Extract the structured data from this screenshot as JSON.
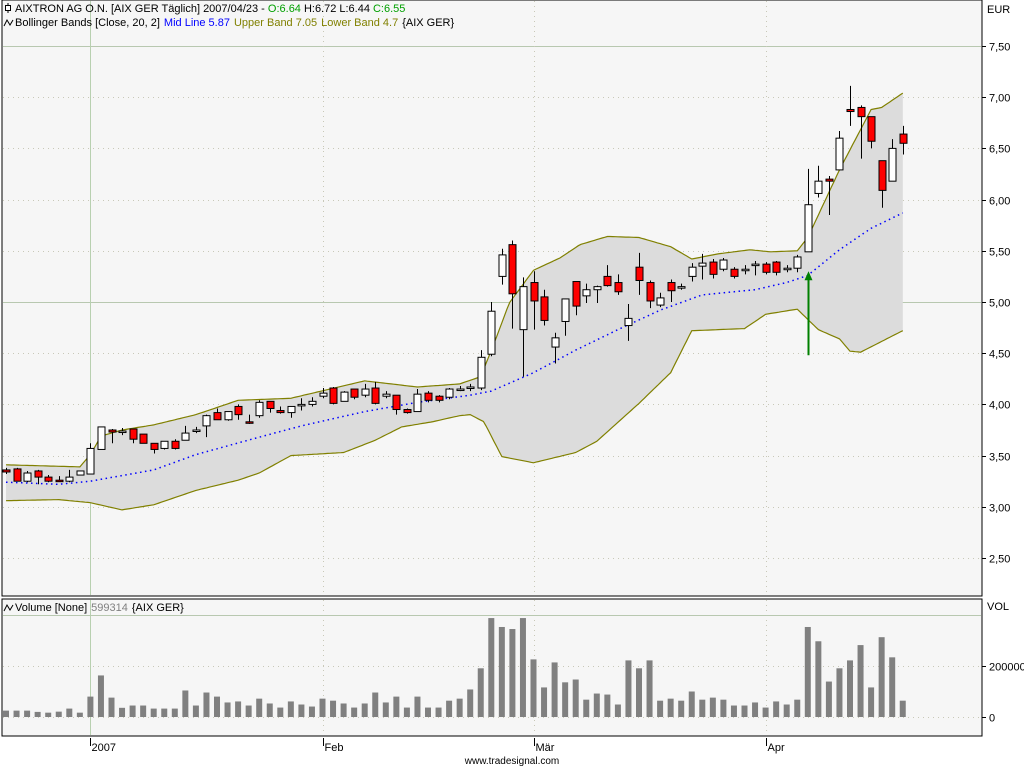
{
  "legend": {
    "symbol": "AIXTRON AG O.N. [AIX GER  Täglich] 2007/04/23 - ",
    "open": "O:6.64",
    "high": "H:6.72",
    "low": "L:6.44",
    "close": "C:6.55",
    "bb_name": "Bollinger Bands [Close, 20, 2]",
    "bb_mid": "Mid Line 5.87",
    "bb_upper": "Upper Band 7.05",
    "bb_lower": "Lower Band 4.7",
    "bb_symbol": "{AIX GER}",
    "vol_name": "Volume [None]",
    "vol_value": "599314",
    "vol_symbol": "{AIX GER}"
  },
  "footer": "www.tradesignal.com",
  "colors": {
    "up_body": "#ffffff",
    "down_body": "#ff0000",
    "band_fill": "#dcdcdc",
    "band_line": "#808000",
    "mid_line": "#0000ff",
    "volume": "#808080",
    "arrow": "#008000",
    "legend_green": "#00a000",
    "legend_blue": "#0000ff",
    "legend_olive": "#808000",
    "legend_gray": "#808080"
  },
  "chart_data": [
    {
      "type": "candlestick",
      "title": "AIXTRON AG O.N. [AIX GER Täglich]",
      "ylabel": "EUR",
      "ylim": [
        2.2,
        7.9
      ],
      "yticks": [
        {
          "value": 7.5,
          "label": "7,50"
        },
        {
          "value": 7.0,
          "label": "7,00"
        },
        {
          "value": 6.5,
          "label": "6,50"
        },
        {
          "value": 6.0,
          "label": "6,00"
        },
        {
          "value": 5.5,
          "label": "5,50"
        },
        {
          "value": 5.0,
          "label": "5,00"
        },
        {
          "value": 4.5,
          "label": "4,50"
        },
        {
          "value": 4.0,
          "label": "4,00"
        },
        {
          "value": 3.5,
          "label": "3,50"
        },
        {
          "value": 3.0,
          "label": "3,00"
        },
        {
          "value": 2.5,
          "label": "2,50"
        }
      ],
      "xticks": [
        {
          "index": 8,
          "label": "2007"
        },
        {
          "index": 30,
          "label": "Feb"
        },
        {
          "index": 50,
          "label": "Mär"
        },
        {
          "index": 72,
          "label": "Apr"
        }
      ],
      "ohlc": [
        [
          3.36,
          3.38,
          3.32,
          3.34
        ],
        [
          3.37,
          3.38,
          3.25,
          3.25
        ],
        [
          3.25,
          3.35,
          3.24,
          3.33
        ],
        [
          3.35,
          3.36,
          3.22,
          3.29
        ],
        [
          3.29,
          3.31,
          3.24,
          3.25
        ],
        [
          3.26,
          3.3,
          3.25,
          3.25
        ],
        [
          3.25,
          3.36,
          3.24,
          3.29
        ],
        [
          3.31,
          3.35,
          3.31,
          3.35
        ],
        [
          3.32,
          3.62,
          3.32,
          3.57
        ],
        [
          3.56,
          3.78,
          3.56,
          3.78
        ],
        [
          3.75,
          3.76,
          3.62,
          3.73
        ],
        [
          3.74,
          3.77,
          3.7,
          3.74
        ],
        [
          3.76,
          3.76,
          3.62,
          3.66
        ],
        [
          3.71,
          3.71,
          3.62,
          3.62
        ],
        [
          3.62,
          3.62,
          3.52,
          3.56
        ],
        [
          3.57,
          3.64,
          3.56,
          3.64
        ],
        [
          3.64,
          3.66,
          3.56,
          3.57
        ],
        [
          3.65,
          3.79,
          3.65,
          3.72
        ],
        [
          3.75,
          3.78,
          3.72,
          3.75
        ],
        [
          3.79,
          3.9,
          3.68,
          3.89
        ],
        [
          3.92,
          3.96,
          3.85,
          3.85
        ],
        [
          3.85,
          3.93,
          3.84,
          3.93
        ],
        [
          3.98,
          4.0,
          3.85,
          3.9
        ],
        [
          3.83,
          3.9,
          3.81,
          3.82
        ],
        [
          3.89,
          4.04,
          3.87,
          4.02
        ],
        [
          4.03,
          4.03,
          3.92,
          3.96
        ],
        [
          3.94,
          3.98,
          3.91,
          3.92
        ],
        [
          3.92,
          3.98,
          3.87,
          3.98
        ],
        [
          4.0,
          4.06,
          3.94,
          4.0
        ],
        [
          4.0,
          4.07,
          3.98,
          4.03
        ],
        [
          4.08,
          4.16,
          4.06,
          4.11
        ],
        [
          4.16,
          4.17,
          4.0,
          4.01
        ],
        [
          4.03,
          4.13,
          4.03,
          4.12
        ],
        [
          4.15,
          4.15,
          4.05,
          4.07
        ],
        [
          4.09,
          4.2,
          4.07,
          4.15
        ],
        [
          4.16,
          4.22,
          4.0,
          4.01
        ],
        [
          4.08,
          4.13,
          4.06,
          4.1
        ],
        [
          4.09,
          4.09,
          3.9,
          3.95
        ],
        [
          3.95,
          3.96,
          3.91,
          3.92
        ],
        [
          3.93,
          4.15,
          3.93,
          4.1
        ],
        [
          4.11,
          4.13,
          4.02,
          4.04
        ],
        [
          4.08,
          4.09,
          4.02,
          4.04
        ],
        [
          4.07,
          4.16,
          4.05,
          4.15
        ],
        [
          4.15,
          4.18,
          4.13,
          4.15
        ],
        [
          4.17,
          4.2,
          4.13,
          4.17
        ],
        [
          4.16,
          4.53,
          4.14,
          4.46
        ],
        [
          4.49,
          5.0,
          4.47,
          4.91
        ],
        [
          5.25,
          5.52,
          5.17,
          5.46
        ],
        [
          5.56,
          5.6,
          4.74,
          5.08
        ],
        [
          4.73,
          5.24,
          4.27,
          5.15
        ],
        [
          5.19,
          5.3,
          4.73,
          5.01
        ],
        [
          5.05,
          5.12,
          4.77,
          4.82
        ],
        [
          4.56,
          4.7,
          4.4,
          4.65
        ],
        [
          4.81,
          5.03,
          4.67,
          5.03
        ],
        [
          5.2,
          5.2,
          4.87,
          4.96
        ],
        [
          5.06,
          5.18,
          4.99,
          5.12
        ],
        [
          5.12,
          5.16,
          4.99,
          5.15
        ],
        [
          5.25,
          5.36,
          5.15,
          5.16
        ],
        [
          5.19,
          5.27,
          5.07,
          5.1
        ],
        [
          4.77,
          4.98,
          4.62,
          4.84
        ],
        [
          5.34,
          5.48,
          5.07,
          5.21
        ],
        [
          5.19,
          5.21,
          4.94,
          5.01
        ],
        [
          4.97,
          5.09,
          4.95,
          5.04
        ],
        [
          5.19,
          5.22,
          5.0,
          5.11
        ],
        [
          5.15,
          5.18,
          5.12,
          5.15
        ],
        [
          5.25,
          5.38,
          5.2,
          5.34
        ],
        [
          5.35,
          5.47,
          5.22,
          5.38
        ],
        [
          5.39,
          5.42,
          5.23,
          5.27
        ],
        [
          5.32,
          5.43,
          5.3,
          5.41
        ],
        [
          5.32,
          5.34,
          5.23,
          5.25
        ],
        [
          5.32,
          5.36,
          5.27,
          5.32
        ],
        [
          5.37,
          5.4,
          5.26,
          5.37
        ],
        [
          5.37,
          5.39,
          5.27,
          5.29
        ],
        [
          5.39,
          5.4,
          5.26,
          5.29
        ],
        [
          5.33,
          5.36,
          5.29,
          5.33
        ],
        [
          5.33,
          5.46,
          5.29,
          5.44
        ],
        [
          5.49,
          6.3,
          5.49,
          5.95
        ],
        [
          6.06,
          6.33,
          6.02,
          6.18
        ],
        [
          6.2,
          6.23,
          5.85,
          6.18
        ],
        [
          6.29,
          6.67,
          6.29,
          6.6
        ],
        [
          6.88,
          7.11,
          6.72,
          6.86
        ],
        [
          6.9,
          6.92,
          6.4,
          6.81
        ],
        [
          6.81,
          6.81,
          6.5,
          6.57
        ],
        [
          6.38,
          6.38,
          5.92,
          6.09
        ],
        [
          6.18,
          6.59,
          6.18,
          6.5
        ],
        [
          6.64,
          6.72,
          6.44,
          6.55
        ]
      ],
      "bollinger": {
        "upper": [
          [
            0,
            3.41
          ],
          [
            7,
            3.39
          ],
          [
            8,
            3.51
          ],
          [
            9,
            3.69
          ],
          [
            11,
            3.75
          ],
          [
            14,
            3.8
          ],
          [
            18,
            3.9
          ],
          [
            22,
            4.04
          ],
          [
            27,
            4.06
          ],
          [
            34,
            4.23
          ],
          [
            39,
            4.17
          ],
          [
            43,
            4.2
          ],
          [
            45,
            4.27
          ],
          [
            46.5,
            4.66
          ],
          [
            47.7,
            4.99
          ],
          [
            50,
            5.31
          ],
          [
            52.5,
            5.43
          ],
          [
            54.4,
            5.56
          ],
          [
            57,
            5.64
          ],
          [
            60,
            5.63
          ],
          [
            63,
            5.54
          ],
          [
            65,
            5.42
          ],
          [
            67.5,
            5.47
          ],
          [
            70.5,
            5.51
          ],
          [
            72.5,
            5.49
          ],
          [
            75,
            5.5
          ],
          [
            76,
            5.63
          ],
          [
            79,
            6.29
          ],
          [
            82,
            6.88
          ],
          [
            83,
            6.9
          ],
          [
            85,
            7.04
          ]
        ],
        "mid": [
          [
            0,
            3.24
          ],
          [
            5,
            3.22
          ],
          [
            8,
            3.25
          ],
          [
            14,
            3.36
          ],
          [
            18,
            3.51
          ],
          [
            24,
            3.68
          ],
          [
            28,
            3.79
          ],
          [
            34,
            3.93
          ],
          [
            39,
            4.02
          ],
          [
            44,
            4.09
          ],
          [
            46,
            4.13
          ],
          [
            50,
            4.31
          ],
          [
            54,
            4.53
          ],
          [
            58,
            4.73
          ],
          [
            62,
            4.92
          ],
          [
            66,
            5.07
          ],
          [
            71,
            5.12
          ],
          [
            74,
            5.19
          ],
          [
            76,
            5.26
          ],
          [
            79,
            5.51
          ],
          [
            82,
            5.72
          ],
          [
            85,
            5.87
          ]
        ],
        "lower": [
          [
            0,
            3.06
          ],
          [
            5,
            3.07
          ],
          [
            8,
            3.04
          ],
          [
            11,
            2.97
          ],
          [
            14,
            3.02
          ],
          [
            18,
            3.16
          ],
          [
            22,
            3.26
          ],
          [
            24,
            3.33
          ],
          [
            27,
            3.5
          ],
          [
            32,
            3.53
          ],
          [
            35,
            3.65
          ],
          [
            37.5,
            3.78
          ],
          [
            40.4,
            3.83
          ],
          [
            43,
            3.89
          ],
          [
            44,
            3.9
          ],
          [
            45.3,
            3.83
          ],
          [
            47,
            3.49
          ],
          [
            50,
            3.43
          ],
          [
            54,
            3.53
          ],
          [
            56,
            3.64
          ],
          [
            60,
            4.01
          ],
          [
            63,
            4.31
          ],
          [
            65,
            4.72
          ],
          [
            70,
            4.74
          ],
          [
            72,
            4.88
          ],
          [
            75,
            4.93
          ],
          [
            77,
            4.73
          ],
          [
            79,
            4.64
          ],
          [
            80,
            4.52
          ],
          [
            81,
            4.51
          ],
          [
            85,
            4.72
          ]
        ]
      },
      "annotations": [
        {
          "type": "arrow",
          "index": 76,
          "from": 4.48,
          "to": 5.3
        }
      ],
      "grid": true
    },
    {
      "type": "bar",
      "title": "Volume [None]",
      "ylabel": "VOL",
      "ylim": [
        -75000,
        470000
      ],
      "yticks": [
        {
          "value": 200000,
          "label": "200000"
        },
        {
          "value": 0,
          "label": "0"
        }
      ],
      "values": [
        25000,
        25000,
        25000,
        20000,
        17000,
        21000,
        33000,
        17000,
        80000,
        163000,
        76000,
        36000,
        45000,
        45000,
        33000,
        33000,
        33000,
        104000,
        45000,
        96000,
        80000,
        57000,
        61000,
        45000,
        72000,
        53000,
        37000,
        61000,
        49000,
        41000,
        72000,
        64000,
        53000,
        37000,
        53000,
        96000,
        57000,
        80000,
        37000,
        80000,
        37000,
        37000,
        64000,
        72000,
        108000,
        191000,
        388000,
        353000,
        345000,
        388000,
        226000,
        116000,
        214000,
        136000,
        147000,
        68000,
        92000,
        88000,
        49000,
        222000,
        191000,
        222000,
        64000,
        72000,
        64000,
        100000,
        68000,
        76000,
        68000,
        45000,
        45000,
        57000,
        37000,
        61000,
        49000,
        68000,
        353000,
        297000,
        139000,
        191000,
        222000,
        282000,
        116000,
        313000,
        234000,
        64000
      ],
      "grid": true
    }
  ]
}
